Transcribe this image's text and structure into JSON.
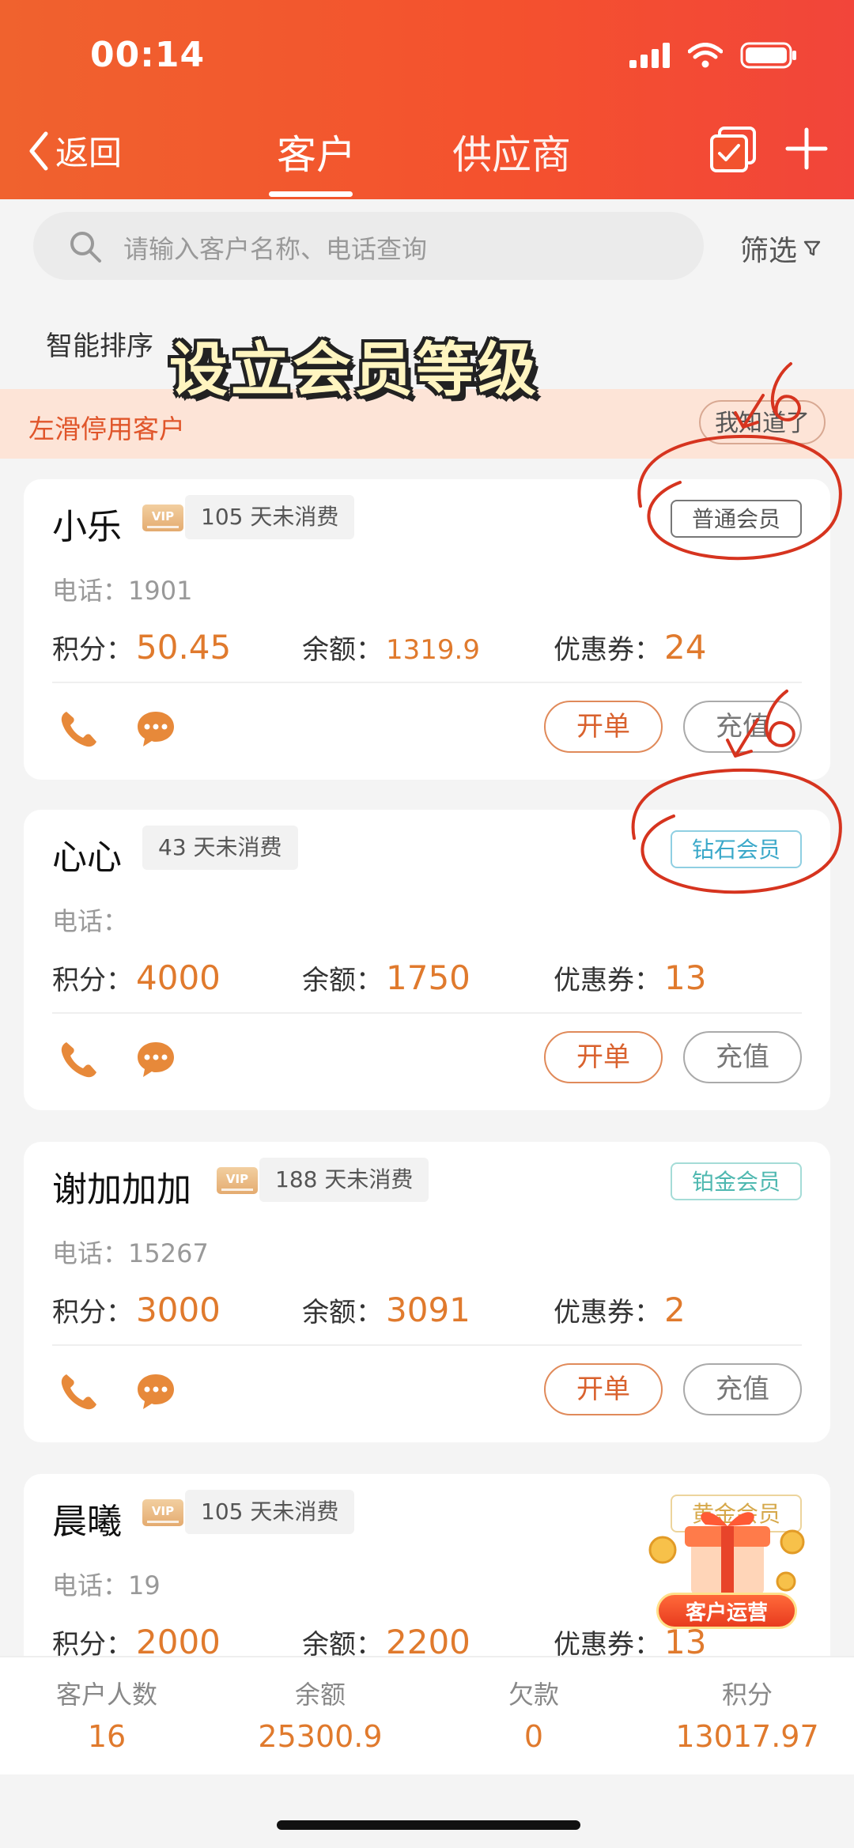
{
  "status_bar": {
    "time": "00:14"
  },
  "nav": {
    "back_label": "返回",
    "tabs": [
      {
        "label": "客户"
      },
      {
        "label": "供应商"
      }
    ]
  },
  "search": {
    "placeholder": "请输入客户名称、电话查询",
    "filter_label": "筛选"
  },
  "sort_label": "智能排序",
  "overlay_title": "设立会员等级",
  "notice": {
    "text": "左滑停用客户",
    "button": "我知道了"
  },
  "labels": {
    "phone": "电话：",
    "points": "积分：",
    "balance": "余额：",
    "coupons": "优惠券：",
    "order_button": "开单",
    "charge_button": "充值",
    "vip": "VIP"
  },
  "customers": [
    {
      "name": "小乐",
      "vip": true,
      "inactive_days": "105 天未消费",
      "level": "普通会员",
      "level_color": "#555555",
      "phone": "1901",
      "points": "50.45",
      "balance": "1319.9",
      "coupons": "24"
    },
    {
      "name": "心心",
      "vip": false,
      "inactive_days": "43 天未消费",
      "level": "钻石会员",
      "level_color": "#3aa8c9",
      "phone": "",
      "points": "4000",
      "balance": "1750",
      "coupons": "13"
    },
    {
      "name": "谢加加加",
      "vip": true,
      "inactive_days": "188 天未消费",
      "level": "铂金会员",
      "level_color": "#4fb8b0",
      "phone": "15267",
      "points": "3000",
      "balance": "3091",
      "coupons": "2"
    },
    {
      "name": "晨曦",
      "vip": true,
      "inactive_days": "105 天未消费",
      "level": "黄金会员",
      "level_color": "#d6a84a",
      "phone": "19",
      "points": "2000",
      "balance": "2200",
      "coupons": "13"
    }
  ],
  "promo_label": "客户运营",
  "footer": [
    {
      "label": "客户人数",
      "value": "16"
    },
    {
      "label": "余额",
      "value": "25300.9"
    },
    {
      "label": "欠款",
      "value": "0"
    },
    {
      "label": "积分",
      "value": "13017.97"
    }
  ]
}
